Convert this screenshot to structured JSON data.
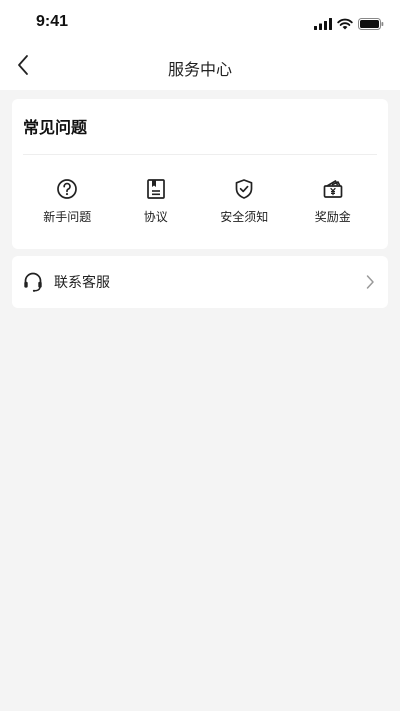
{
  "status_bar": {
    "time": "9:41",
    "icons": [
      "signal-icon",
      "wifi-icon",
      "battery-icon"
    ]
  },
  "nav": {
    "title": "服务中心",
    "back_icon": "chevron-left-icon"
  },
  "faq": {
    "title": "常见问题",
    "items": [
      {
        "label": "新手问题",
        "icon": "question-circle-icon"
      },
      {
        "label": "协议",
        "icon": "document-icon"
      },
      {
        "label": "安全须知",
        "icon": "shield-check-icon"
      },
      {
        "label": "奖励金",
        "icon": "reward-wallet-icon"
      }
    ]
  },
  "contact": {
    "label": "联系客服",
    "icon": "headset-icon",
    "arrow_icon": "chevron-right-icon"
  },
  "colors": {
    "background": "#f4f4f4",
    "card": "#ffffff",
    "text": "#222222",
    "chevron": "#999999"
  }
}
